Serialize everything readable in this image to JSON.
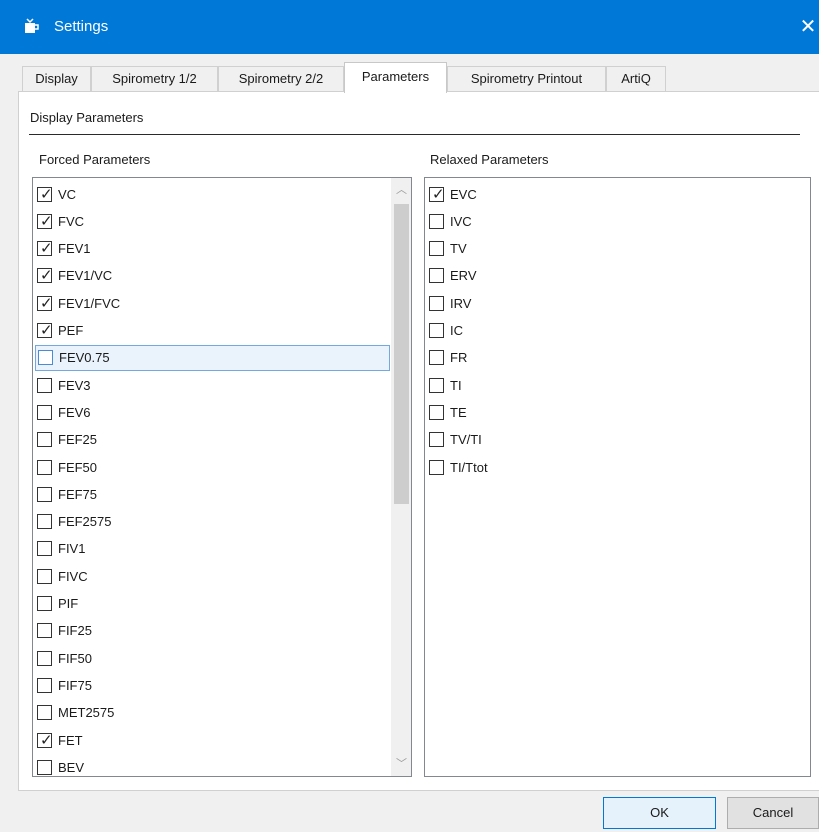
{
  "window": {
    "title": "Settings",
    "close_glyph": "✕",
    "app_icon": "spirometer-app-icon"
  },
  "tabs": [
    {
      "label": "Display",
      "active": false
    },
    {
      "label": "Spirometry 1/2",
      "active": false
    },
    {
      "label": "Spirometry 2/2",
      "active": false
    },
    {
      "label": "Parameters",
      "active": true
    },
    {
      "label": "Spirometry Printout",
      "active": false
    },
    {
      "label": "ArtiQ",
      "active": false
    }
  ],
  "section": {
    "title": "Display Parameters"
  },
  "forced": {
    "label": "Forced Parameters",
    "items": [
      {
        "label": "VC",
        "checked": true
      },
      {
        "label": "FVC",
        "checked": true
      },
      {
        "label": "FEV1",
        "checked": true
      },
      {
        "label": "FEV1/VC",
        "checked": true
      },
      {
        "label": "FEV1/FVC",
        "checked": true
      },
      {
        "label": "PEF",
        "checked": true
      },
      {
        "label": "FEV0.75",
        "checked": false,
        "selected": true
      },
      {
        "label": "FEV3",
        "checked": false
      },
      {
        "label": "FEV6",
        "checked": false
      },
      {
        "label": "FEF25",
        "checked": false
      },
      {
        "label": "FEF50",
        "checked": false
      },
      {
        "label": "FEF75",
        "checked": false
      },
      {
        "label": "FEF2575",
        "checked": false
      },
      {
        "label": "FIV1",
        "checked": false
      },
      {
        "label": "FIVC",
        "checked": false
      },
      {
        "label": "PIF",
        "checked": false
      },
      {
        "label": "FIF25",
        "checked": false
      },
      {
        "label": "FIF50",
        "checked": false
      },
      {
        "label": "FIF75",
        "checked": false
      },
      {
        "label": "MET2575",
        "checked": false
      },
      {
        "label": "FET",
        "checked": true
      },
      {
        "label": "BEV",
        "checked": false
      }
    ],
    "scroll": {
      "up_glyph": "︿",
      "down_glyph": "﹀"
    }
  },
  "relaxed": {
    "label": "Relaxed Parameters",
    "items": [
      {
        "label": "EVC",
        "checked": true
      },
      {
        "label": "IVC",
        "checked": false
      },
      {
        "label": "TV",
        "checked": false
      },
      {
        "label": "ERV",
        "checked": false
      },
      {
        "label": "IRV",
        "checked": false
      },
      {
        "label": "IC",
        "checked": false
      },
      {
        "label": "FR",
        "checked": false
      },
      {
        "label": "TI",
        "checked": false
      },
      {
        "label": "TE",
        "checked": false
      },
      {
        "label": "TV/TI",
        "checked": false
      },
      {
        "label": "TI/Ttot",
        "checked": false
      }
    ]
  },
  "buttons": {
    "ok": "OK",
    "cancel": "Cancel"
  },
  "colors": {
    "titlebar": "#0078d7",
    "selection_border": "#74a9e0",
    "selection_fill": "#eaf3fc"
  }
}
